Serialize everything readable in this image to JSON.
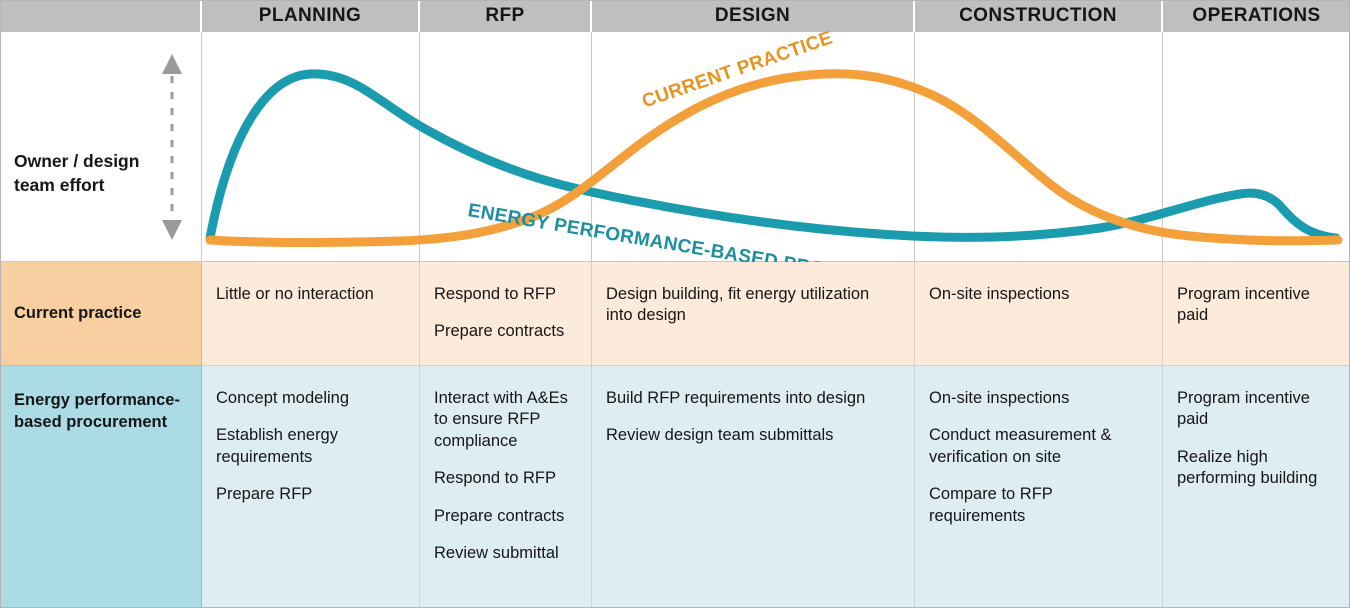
{
  "phases": [
    {
      "id": "planning",
      "label": "PLANNING"
    },
    {
      "id": "rfp",
      "label": "RFP"
    },
    {
      "id": "design",
      "label": "DESIGN"
    },
    {
      "id": "construction",
      "label": "CONSTRUCTION"
    },
    {
      "id": "operations",
      "label": "OPERATIONS"
    }
  ],
  "axis": {
    "label": "Owner / design team effort",
    "arrow_icon": "double-arrow-vertical-dashed-icon"
  },
  "curves": {
    "current_practice": {
      "label": "CURRENT PRACTICE",
      "color": "#f4a03a"
    },
    "energy_performance": {
      "label": "ENERGY PERFORMANCE-BASED PROCUREMENT",
      "color": "#1b9cae"
    }
  },
  "rows": [
    {
      "id": "current-practice",
      "header": "Current practice",
      "header_color": "#f8cfa0",
      "cell_color": "#fceada",
      "cells": [
        [
          "Little or no interaction"
        ],
        [
          "Respond to RFP",
          "Prepare contracts"
        ],
        [
          "Design building, fit energy utilization into design"
        ],
        [
          "On-site inspections"
        ],
        [
          "Program incentive paid"
        ]
      ]
    },
    {
      "id": "energy-performance-based-procurement",
      "header": "Energy performance-based procurement",
      "header_color": "#abdce6",
      "cell_color": "#ddedf2",
      "cells": [
        [
          "Concept modeling",
          "Establish energy requirements",
          "Prepare RFP"
        ],
        [
          "Interact with A&Es to ensure RFP compliance",
          "Respond to RFP",
          "Prepare contracts",
          "Review submittal"
        ],
        [
          "Build RFP requirements into design",
          "Review design team submittals"
        ],
        [
          "On-site inspections",
          "Conduct measurement & verification on site",
          "Compare to RFP requirements"
        ],
        [
          "Program incentive paid",
          "Realize high performing building"
        ]
      ]
    }
  ],
  "chart_data": {
    "type": "line",
    "title": "",
    "xlabel": "",
    "ylabel": "Owner / design team effort",
    "categories": [
      "PLANNING",
      "RFP",
      "DESIGN",
      "CONSTRUCTION",
      "OPERATIONS"
    ],
    "grid": true,
    "legend": "inline-curve-labels",
    "series": [
      {
        "name": "CURRENT PRACTICE",
        "color": "#f4a03a",
        "values": [
          2,
          3,
          10,
          55,
          96,
          92,
          60,
          22,
          8,
          2
        ]
      },
      {
        "name": "ENERGY PERFORMANCE-BASED PROCUREMENT",
        "color": "#1b9cae",
        "values": [
          2,
          98,
          86,
          62,
          40,
          22,
          10,
          6,
          24,
          4
        ]
      }
    ],
    "ylim": [
      0,
      100
    ]
  }
}
